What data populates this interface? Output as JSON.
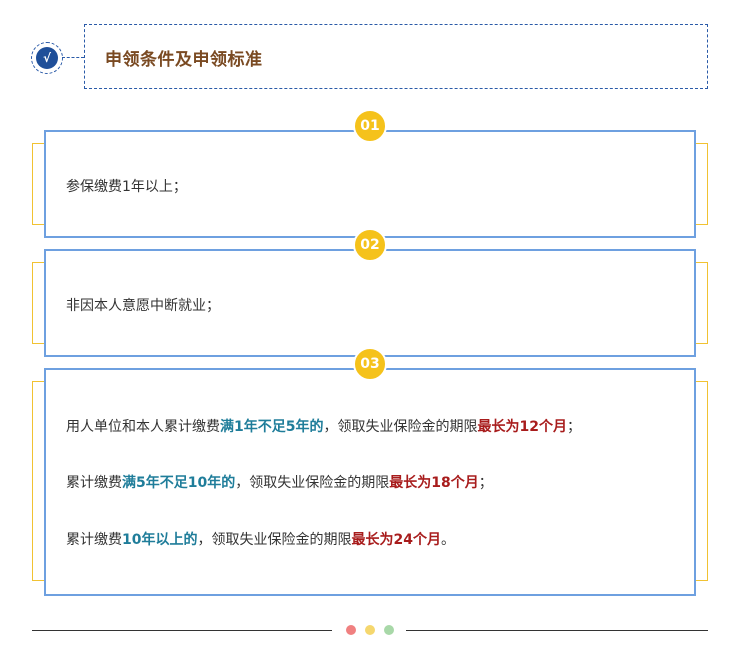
{
  "header": {
    "title": "申领条件及申领标准",
    "check_glyph": "√"
  },
  "steps": [
    {
      "badge": "01",
      "text": "参保缴费1年以上；"
    },
    {
      "badge": "02",
      "text": "非因本人意愿中断就业；"
    },
    {
      "badge": "03",
      "lines": [
        {
          "p1": "用人单位和本人累计缴费",
          "h1": "满1年不足5年的",
          "p2": "，领取失业保险金的期限",
          "h2": "最长为12个月",
          "p3": "；"
        },
        {
          "p1": "累计缴费",
          "h1": "满5年不足10年的",
          "p2": "，领取失业保险金的期限",
          "h2": "最长为18个月",
          "p3": "；"
        },
        {
          "p1": "累计缴费",
          "h1": "10年以上的",
          "p2": "，领取失业保险金的期限",
          "h2": "最长为24个月",
          "p3": "。"
        }
      ]
    }
  ],
  "colors": {
    "accent_blue": "#1f7d9a",
    "accent_red": "#a81c1c",
    "badge_yellow": "#f5c21b",
    "card_border": "#6ea0e0"
  },
  "footer": {
    "dots": [
      "#f08080",
      "#f5d76e",
      "#a8d8a8"
    ]
  }
}
